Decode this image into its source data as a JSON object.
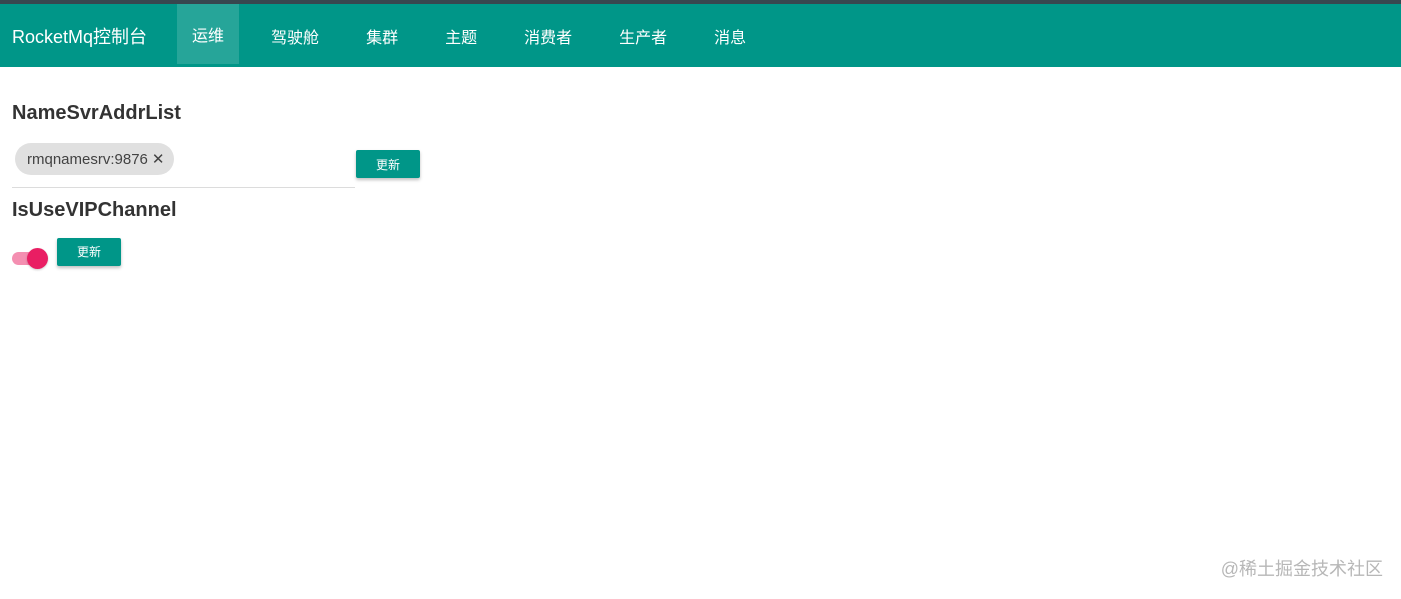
{
  "colors": {
    "primary": "#009688",
    "topbar_line": "#37474f",
    "toggle_accent": "#e91e63",
    "toggle_track": "#f48fb1",
    "chip_bg": "#e0e0e0"
  },
  "navbar": {
    "brand": "RocketMq控制台",
    "items": [
      {
        "label": "运维",
        "active": true
      },
      {
        "label": "驾驶舱",
        "active": false
      },
      {
        "label": "集群",
        "active": false
      },
      {
        "label": "主题",
        "active": false
      },
      {
        "label": "消费者",
        "active": false
      },
      {
        "label": "生产者",
        "active": false
      },
      {
        "label": "消息",
        "active": false
      }
    ]
  },
  "ops": {
    "namesrv": {
      "title": "NameSvrAddrList",
      "chips": [
        {
          "label": "rmqnamesrv:9876",
          "close_icon": "close-icon",
          "close_glyph": "✕"
        }
      ],
      "update_label": "更新"
    },
    "vip": {
      "title": "IsUseVIPChannel",
      "enabled": true,
      "update_label": "更新"
    }
  },
  "watermark": "@稀土掘金技术社区"
}
